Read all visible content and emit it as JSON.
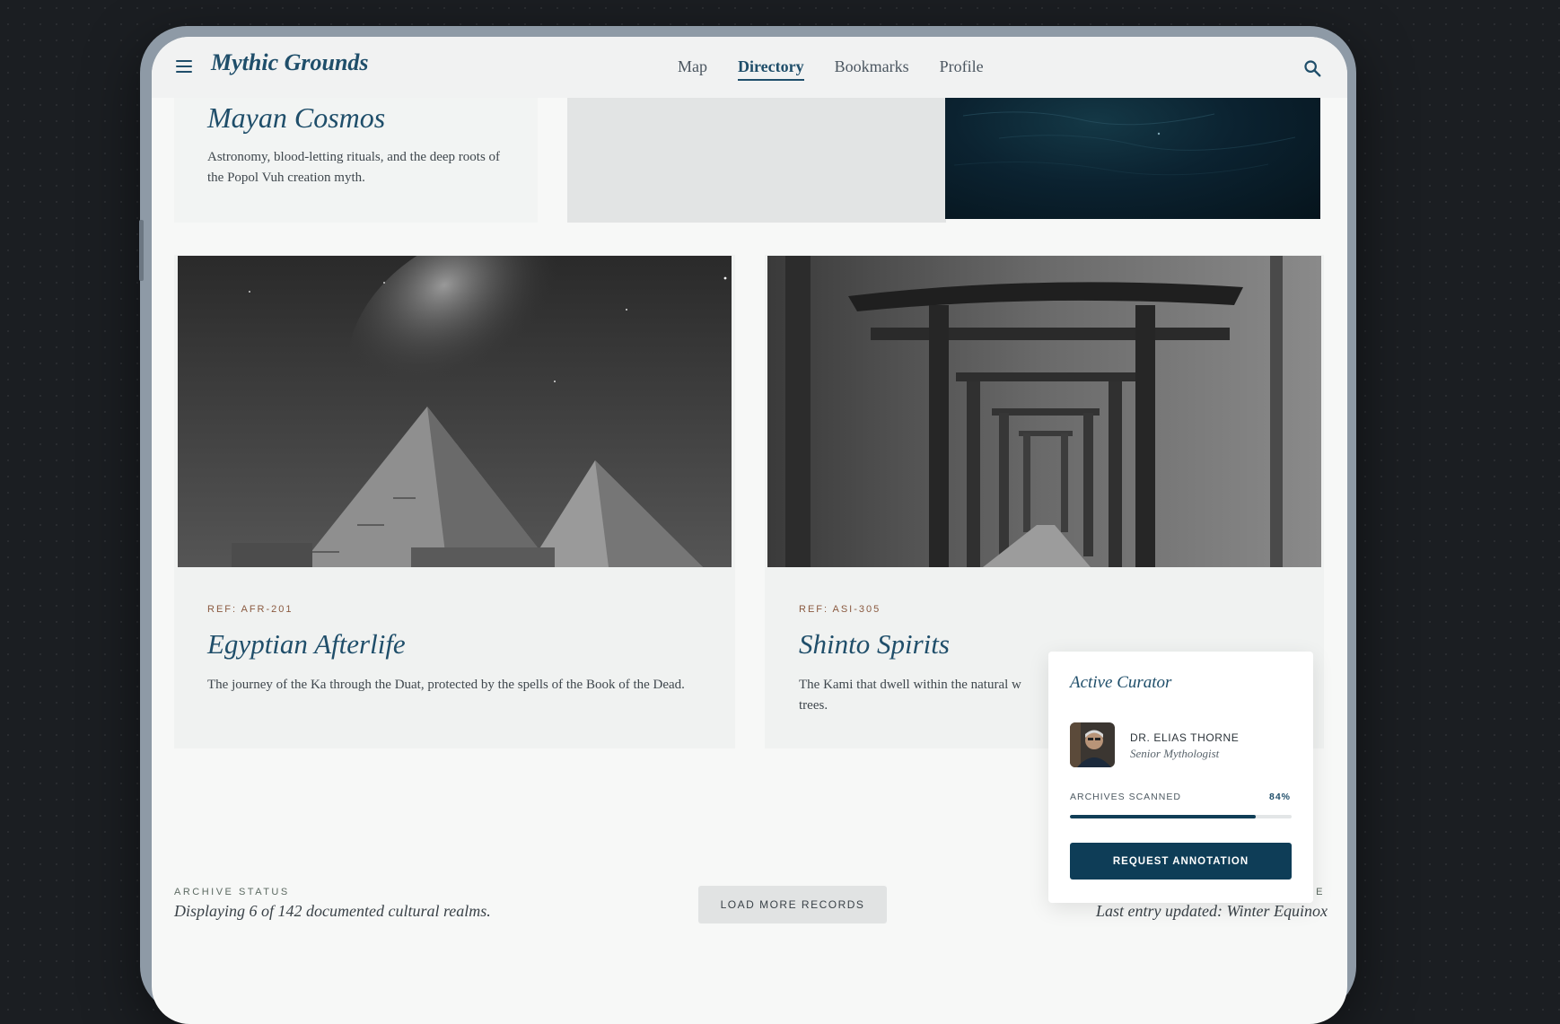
{
  "header": {
    "brand": "Mythic Grounds",
    "nav": [
      {
        "label": "Map",
        "active": false
      },
      {
        "label": "Directory",
        "active": true
      },
      {
        "label": "Bookmarks",
        "active": false
      },
      {
        "label": "Profile",
        "active": false
      }
    ],
    "icons": {
      "menu": "menu-icon",
      "search": "search-icon"
    }
  },
  "mayan": {
    "title": "Mayan Cosmos",
    "description": "Astronomy, blood-letting rituals, and the deep roots of the Popol Vuh creation myth."
  },
  "cards": [
    {
      "ref": "REF: AFR-201",
      "title": "Egyptian Afterlife",
      "description": "The journey of the Ka through the Duat, protected by the spells of the Book of the Dead."
    },
    {
      "ref": "REF: ASI-305",
      "title": "Shinto Spirits",
      "description": "The Kami that dwell within the natural w",
      "description_end": "trees."
    }
  ],
  "footer": {
    "status_label": "ARCHIVE STATUS",
    "status_text": "Displaying 6 of 142 documented cultural realms.",
    "load_more": "LOAD MORE RECORDS",
    "update_label_fragment": "E",
    "update_text": "Last entry updated: Winter Equinox"
  },
  "curator": {
    "title": "Active Curator",
    "name": "DR. ELIAS THORNE",
    "role": "Senior Mythologist",
    "progress_label": "ARCHIVES SCANNED",
    "progress_value": "84%",
    "progress_fraction": 0.84,
    "button": "REQUEST ANNOTATION"
  },
  "colors": {
    "accent": "#1f4e6a",
    "button_dark": "#0e3d57",
    "ref_text": "#8a5a40"
  }
}
